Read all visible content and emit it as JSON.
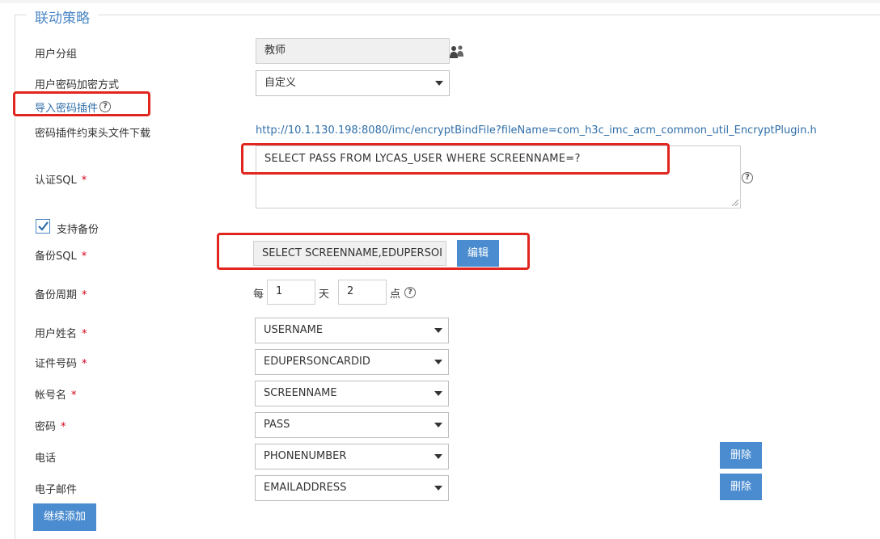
{
  "section": {
    "legend": "联动策略"
  },
  "form": {
    "user_group": {
      "label": "用户分组",
      "value": "教师"
    },
    "encrypt_method": {
      "label": "用户密码加密方式",
      "value": "自定义"
    },
    "import_plugin": {
      "label": "导入密码插件"
    },
    "plugin_download": {
      "label": "密码插件约束头文件下载",
      "url": "http://10.1.130.198:8080/imc/encryptBindFile?fileName=com_h3c_imc_acm_common_util_EncryptPlugin.h"
    },
    "auth_sql": {
      "label": "认证SQL",
      "required": "*",
      "value": "SELECT  PASS  FROM  LYCAS_USER  WHERE  SCREENNAME=?"
    },
    "support_backup": {
      "label": "支持备份",
      "checked": true
    },
    "backup_sql": {
      "label": "备份SQL",
      "required": "*",
      "value": "SELECT  SCREENNAME,EDUPERSOI",
      "edit_label": "编辑"
    },
    "backup_period": {
      "label": "备份周期",
      "required": "*",
      "every": "每",
      "day_value": "1",
      "day_unit": "天",
      "hour_value": "2",
      "hour_unit": "点"
    },
    "user_name": {
      "label": "用户姓名",
      "required": "*",
      "value": "USERNAME"
    },
    "id_number": {
      "label": "证件号码",
      "required": "*",
      "value": "EDUPERSONCARDID"
    },
    "account_name": {
      "label": "帐号名",
      "required": "*",
      "value": "SCREENNAME"
    },
    "password": {
      "label": "密码",
      "required": "*",
      "value": "PASS"
    },
    "phone": {
      "label": "电话",
      "value": "PHONENUMBER",
      "delete_label": "删除"
    },
    "email": {
      "label": "电子邮件",
      "value": "EMAILADDRESS",
      "delete_label": "删除"
    },
    "continue_add_label": "继续添加"
  },
  "icons": {
    "help": "?",
    "group": "user-group-icon"
  },
  "colors": {
    "accent": "#4a8ccf",
    "highlight": "#e0261e",
    "required": "#d0021b",
    "link": "#2f6ea8"
  }
}
